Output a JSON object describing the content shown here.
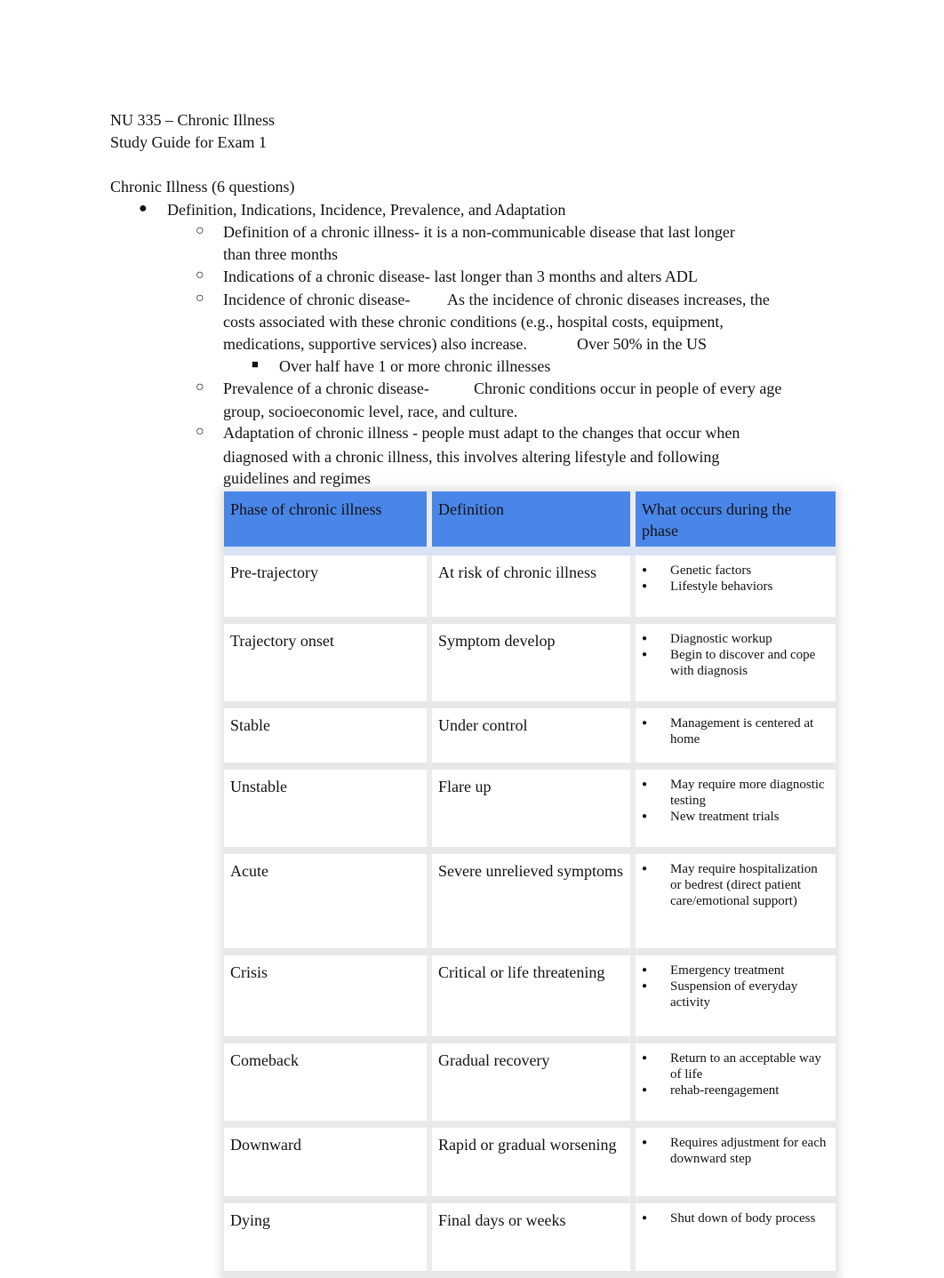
{
  "header": {
    "course": "NU 335 – Chronic Illness",
    "subtitle": "Study Guide for Exam 1"
  },
  "section": {
    "title": "Chronic Illness (6 questions)",
    "topic": "Definition, Indications, Incidence, Prevalence, and Adaptation",
    "items": [
      {
        "term": "Definition of a chronic illness-",
        "text_line1": " it is a non-communicable disease that last longer",
        "text_line2": "than three months"
      },
      {
        "term": "Indications of a chronic disease-",
        "text_line1": " last longer than 3 months and alters ADL"
      },
      {
        "term": "Incidence of chronic disease-",
        "text_line1": "As the incidence of chronic diseases increases, the",
        "text_line2": "costs associated with these chronic conditions (e.g., hospital costs, equipment,",
        "text_line3a": "medications, supportive services) also increase.",
        "text_line3b": "Over 50% in the US",
        "subitem": "Over half have 1 or more chronic illnesses"
      },
      {
        "term": "Prevalence of a chronic disease-",
        "text_line1": "Chronic conditions occur in people of every age",
        "text_line2": "group, socioeconomic level, race, and culture."
      },
      {
        "term": "Adaptation of chronic illness -",
        "text_line1": " people must adapt to the changes that occur when",
        "text_line2": "diagnosed with a chronic illness, this involves altering lifestyle and following",
        "text_line3": "guidelines and regimes"
      }
    ]
  },
  "table": {
    "accent_color": "#4a86e8",
    "headers": [
      "Phase of chronic illness",
      "Definition",
      "What occurs during the phase"
    ],
    "rows": [
      {
        "phase": "Pre-trajectory",
        "definition": "At risk of chronic illness",
        "occurs": [
          "Genetic factors",
          "Lifestyle behaviors"
        ]
      },
      {
        "phase": "Trajectory onset",
        "definition": "Symptom develop",
        "occurs": [
          "Diagnostic workup",
          "Begin to discover and cope with diagnosis"
        ]
      },
      {
        "phase": "Stable",
        "definition": "Under control",
        "occurs": [
          "Management is centered at home"
        ]
      },
      {
        "phase": "Unstable",
        "definition": "Flare up",
        "occurs": [
          "May require more diagnostic testing",
          "New treatment trials"
        ]
      },
      {
        "phase": "Acute",
        "definition": "Severe unrelieved symptoms",
        "occurs": [
          "May require hospitalization or bedrest (direct patient care/emotional support)"
        ]
      },
      {
        "phase": "Crisis",
        "definition": "Critical or life threatening",
        "occurs": [
          "Emergency treatment",
          "Suspension of everyday activity"
        ]
      },
      {
        "phase": "Comeback",
        "definition": "Gradual recovery",
        "occurs": [
          "Return to an acceptable way of life",
          "rehab-reengagement"
        ]
      },
      {
        "phase": "Downward",
        "definition": "Rapid or gradual worsening",
        "occurs": [
          "Requires adjustment for each downward step"
        ]
      },
      {
        "phase": "Dying",
        "definition": "Final days or weeks",
        "occurs": [
          "Shut down of    body process"
        ]
      }
    ]
  }
}
